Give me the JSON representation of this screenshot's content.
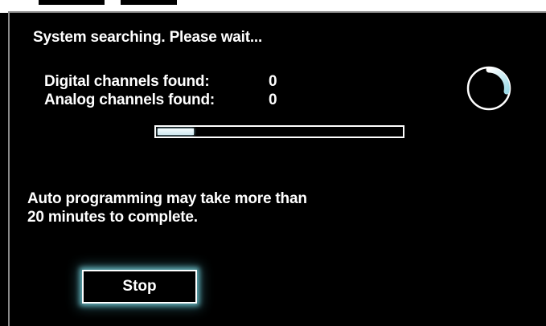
{
  "status": {
    "title": "System searching. Please wait..."
  },
  "counts": {
    "digital_label": "Digital channels found:",
    "digital_value": "0",
    "analog_label": "Analog channels found:",
    "analog_value": "0"
  },
  "progress": {
    "fraction": 0.15
  },
  "note": {
    "line1": "Auto programming may take more than",
    "line2": "20 minutes to complete."
  },
  "buttons": {
    "stop_label": "Stop"
  },
  "icons": {
    "spinner": "loading-spinner-icon"
  },
  "colors": {
    "background": "#000000",
    "text": "#ffffff",
    "focus_glow": "#78d2dc"
  }
}
